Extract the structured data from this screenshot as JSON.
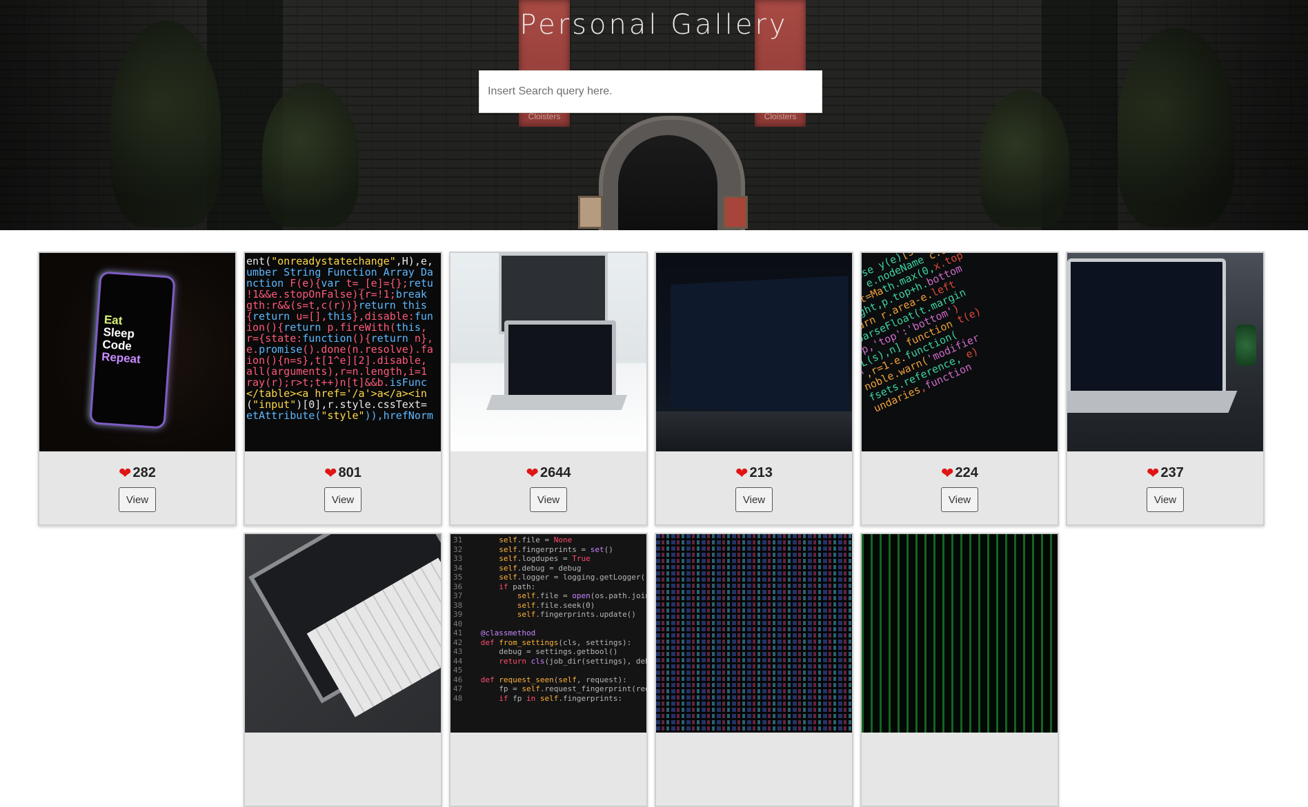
{
  "hero": {
    "title": "Personal Gallery",
    "banner_text": "Cloisters",
    "search": {
      "placeholder": "Insert Search query here.",
      "value": ""
    }
  },
  "gallery": {
    "view_label": "View",
    "items": [
      {
        "subject": "phone-eat-sleep-code-repeat",
        "likes": "282",
        "phone_text": [
          "Eat",
          "Sleep",
          "Code",
          "Repeat"
        ]
      },
      {
        "subject": "javascript-code-closeup",
        "likes": "801"
      },
      {
        "subject": "laptop-on-white-desk",
        "likes": "2644"
      },
      {
        "subject": "laptop-dark-code-editor",
        "likes": "213"
      },
      {
        "subject": "slanted-colored-code",
        "likes": "224"
      },
      {
        "subject": "macbook-with-plant",
        "likes": "237"
      },
      {
        "subject": "laptop-top-down"
      },
      {
        "subject": "python-code-editor"
      },
      {
        "subject": "dense-colored-code"
      },
      {
        "subject": "green-matrix-code"
      }
    ]
  },
  "colors": {
    "heart": "#e01414",
    "card_background": "#e6e6e6",
    "card_border": "#cfcfcf"
  },
  "icons": {
    "like": "heart-icon"
  }
}
